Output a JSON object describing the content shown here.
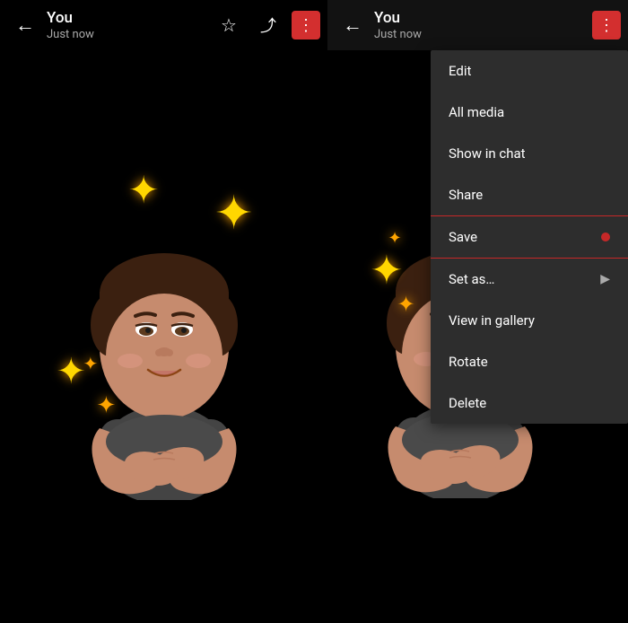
{
  "left_panel": {
    "header": {
      "title": "You",
      "subtitle": "Just now",
      "back_label": "back",
      "star_icon": "★",
      "share_icon": "↑",
      "more_icon": "⋮"
    }
  },
  "right_panel": {
    "header": {
      "title": "You",
      "subtitle": "Just now",
      "back_label": "back",
      "more_icon": "⋮"
    },
    "context_menu": {
      "items": [
        {
          "id": "edit",
          "label": "Edit",
          "has_arrow": false,
          "has_dot": false,
          "special": ""
        },
        {
          "id": "all-media",
          "label": "All media",
          "has_arrow": false,
          "has_dot": false,
          "special": ""
        },
        {
          "id": "show-in-chat",
          "label": "Show in chat",
          "has_arrow": false,
          "has_dot": false,
          "special": ""
        },
        {
          "id": "share",
          "label": "Share",
          "has_arrow": false,
          "has_dot": false,
          "special": ""
        },
        {
          "id": "save",
          "label": "Save",
          "has_arrow": false,
          "has_dot": true,
          "special": "save"
        },
        {
          "id": "set-as",
          "label": "Set as…",
          "has_arrow": true,
          "has_dot": false,
          "special": ""
        },
        {
          "id": "view-in-gallery",
          "label": "View in gallery",
          "has_arrow": false,
          "has_dot": false,
          "special": ""
        },
        {
          "id": "rotate",
          "label": "Rotate",
          "has_arrow": false,
          "has_dot": false,
          "special": ""
        },
        {
          "id": "delete",
          "label": "Delete",
          "has_arrow": false,
          "has_dot": false,
          "special": ""
        }
      ]
    }
  },
  "sparkles": [
    "✦",
    "✦",
    "✦"
  ],
  "colors": {
    "background": "#000000",
    "header_bg": "rgba(0,0,0,0.7)",
    "menu_bg": "#2d2d2d",
    "accent_red": "#c62828",
    "text_white": "#ffffff",
    "text_gray": "#aaaaaa",
    "sparkle_gold": "#FFD700"
  }
}
